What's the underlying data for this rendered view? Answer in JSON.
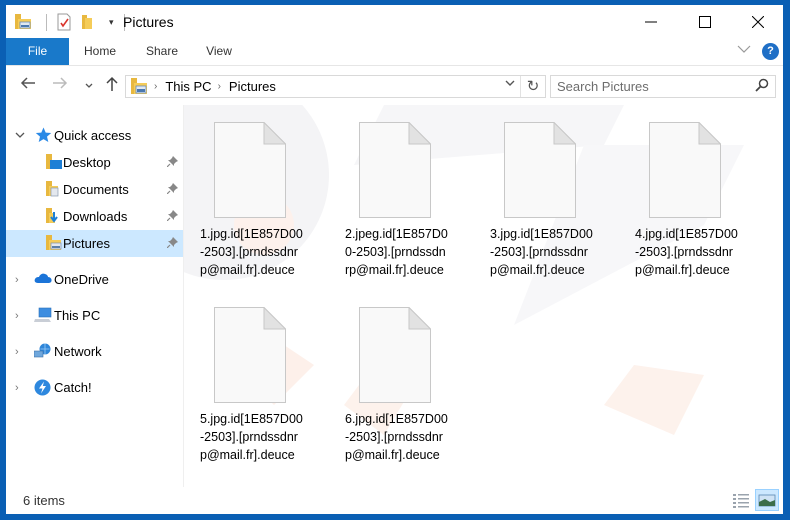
{
  "window": {
    "title": "Pictures",
    "controls": {
      "minimize": "—",
      "maximize": "☐",
      "close": "✕"
    },
    "quick_access_toolbar": {
      "dropdown": "▾"
    }
  },
  "ribbon": {
    "tabs": [
      {
        "label": "File",
        "active": true
      },
      {
        "label": "Home",
        "active": false
      },
      {
        "label": "Share",
        "active": false
      },
      {
        "label": "View",
        "active": false
      }
    ],
    "expand_glyph": "∨",
    "help_glyph": "?"
  },
  "navigation": {
    "back_glyph": "←",
    "forward_glyph": "→",
    "recent_glyph": "∨",
    "up_glyph": "↑",
    "breadcrumb": [
      "This PC",
      "Pictures"
    ],
    "breadcrumb_separator": "›",
    "history_glyph": "∨",
    "refresh_glyph": "↻",
    "search_placeholder": "Search Pictures",
    "search_value": "",
    "search_glyph": "⚲"
  },
  "sidebar": {
    "quick_access": {
      "label": "Quick access",
      "expanded": true,
      "expander_glyph": "∨",
      "items": [
        {
          "label": "Desktop",
          "pinned": true,
          "selected": false
        },
        {
          "label": "Documents",
          "pinned": true,
          "selected": false
        },
        {
          "label": "Downloads",
          "pinned": true,
          "selected": false
        },
        {
          "label": "Pictures",
          "pinned": true,
          "selected": true
        }
      ]
    },
    "roots": [
      {
        "label": "OneDrive",
        "expander_glyph": "›"
      },
      {
        "label": "This PC",
        "expander_glyph": "›"
      },
      {
        "label": "Network",
        "expander_glyph": "›"
      },
      {
        "label": "Catch!",
        "expander_glyph": "›"
      }
    ],
    "pin_glyph": "📌"
  },
  "files": [
    {
      "name": "1.jpg.id[1E857D00-2503].[prndssdnrp@mail.fr].deuce"
    },
    {
      "name": "2.jpeg.id[1E857D00-2503].[prndssdnrp@mail.fr].deuce"
    },
    {
      "name": "3.jpg.id[1E857D00-2503].[prndssdnrp@mail.fr].deuce"
    },
    {
      "name": "4.jpg.id[1E857D00-2503].[prndssdnrp@mail.fr].deuce"
    },
    {
      "name": "5.jpg.id[1E857D00-2503].[prndssdnrp@mail.fr].deuce"
    },
    {
      "name": "6.jpg.id[1E857D00-2503].[prndssdnrp@mail.fr].deuce"
    }
  ],
  "status": {
    "item_count": "6 items"
  },
  "colors": {
    "window_border": "#0a5fb4",
    "file_tab": "#1979ca",
    "selection": "#cce8ff",
    "help": "#1f6fc6"
  }
}
